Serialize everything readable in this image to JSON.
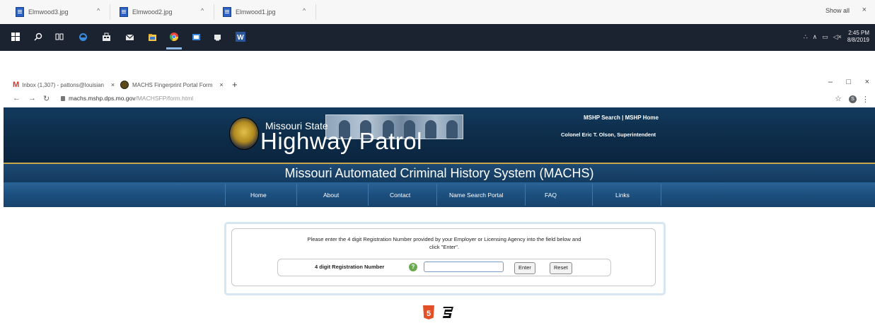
{
  "download_bar": {
    "items": [
      {
        "name": "Elmwood3.jpg"
      },
      {
        "name": "Elmwood2.jpg"
      },
      {
        "name": "Elmwood1.jpg"
      }
    ],
    "show_all": "Show all",
    "close": "×"
  },
  "taskbar": {
    "icons": [
      "windows-start-icon",
      "search-icon",
      "task-view-icon",
      "edge-icon",
      "store-icon",
      "mail-icon",
      "file-explorer-icon",
      "chrome-icon",
      "photos-icon",
      "media-icon",
      "word-icon"
    ],
    "clock_time": "2:45 PM",
    "clock_date": "8/8/2019"
  },
  "browser": {
    "tabs": [
      {
        "label": "Inbox (1,307) - pattons@louisian"
      },
      {
        "label": "MACHS Fingerprint Portal Form"
      }
    ],
    "url_host": "machs.mshp.dps.mo.gov",
    "url_path": "/MACHSFP/form.html",
    "profile_initial": "S"
  },
  "header": {
    "state_label": "Missouri State",
    "title": "Highway Patrol",
    "link_search": "MSHP Search",
    "link_sep": " | ",
    "link_home": "MSHP Home",
    "superintendent": "Colonel Eric T. Olson, Superintendent"
  },
  "system_title": "Missouri Automated Criminal History System (MACHS)",
  "nav": {
    "items": [
      "Home",
      "About",
      "Contact",
      "Name Search Portal",
      "FAQ",
      "Links"
    ]
  },
  "form": {
    "instructions_line1": "Please enter the 4 digit Registration Number provided by your Employer or Licensing Agency into the field below and",
    "instructions_line2": "click \"Enter\".",
    "reg_label": "4 digit Registration Number",
    "help_glyph": "?",
    "reg_value": "",
    "enter_label": "Enter",
    "reset_label": "Reset"
  },
  "footer": {
    "icons": [
      "html5-icon",
      "css3-icon"
    ]
  }
}
